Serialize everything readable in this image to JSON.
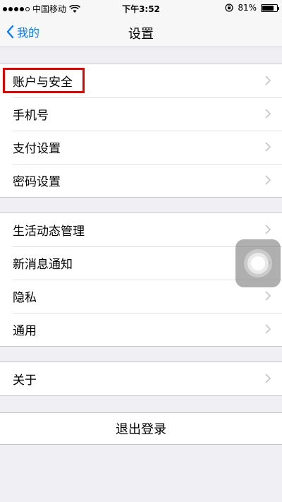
{
  "status_bar": {
    "carrier": "中国移动",
    "time": "下午3:52",
    "battery_text": "81%",
    "battery_level": 0.81,
    "signal_bars": 4,
    "icons": [
      "signal-dots-icon",
      "wifi-icon",
      "rotation-lock-icon",
      "battery-icon"
    ]
  },
  "nav": {
    "back_label": "我的",
    "title": "设置"
  },
  "groups": [
    {
      "items": [
        {
          "label": "账户与安全",
          "highlighted": true
        },
        {
          "label": "手机号"
        },
        {
          "label": "支付设置"
        },
        {
          "label": "密码设置"
        }
      ]
    },
    {
      "items": [
        {
          "label": "生活动态管理"
        },
        {
          "label": "新消息通知"
        },
        {
          "label": "隐私"
        },
        {
          "label": "通用"
        }
      ]
    },
    {
      "items": [
        {
          "label": "关于"
        }
      ]
    }
  ],
  "logout_label": "退出登录",
  "colors": {
    "accent": "#0a7cf5",
    "highlight": "#e00000",
    "background": "#efeff4"
  }
}
